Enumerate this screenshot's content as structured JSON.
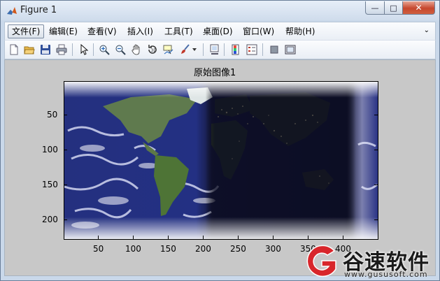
{
  "window": {
    "title": "Figure 1",
    "min_label": "—",
    "max_label": "□",
    "close_label": "✕"
  },
  "menubar": {
    "items": [
      "文件(F)",
      "编辑(E)",
      "查看(V)",
      "插入(I)",
      "工具(T)",
      "桌面(D)",
      "窗口(W)",
      "帮助(H)"
    ],
    "overflow_icon": "chevron-icon"
  },
  "toolbar": {
    "buttons": [
      "new-figure-icon",
      "open-file-icon",
      "save-icon",
      "print-icon",
      "edit-plot-arrow-icon",
      "zoom-in-icon",
      "zoom-out-icon",
      "pan-hand-icon",
      "rotate-3d-icon",
      "data-cursor-icon",
      "brush-icon",
      "dropdown-icon",
      "link-plot-icon",
      "colorbar-icon",
      "legend-icon",
      "hide-plot-tools-icon",
      "show-plot-tools-icon"
    ]
  },
  "plot": {
    "title": "原始图像1",
    "x_ticks": [
      "50",
      "100",
      "150",
      "200",
      "250",
      "300",
      "350",
      "400"
    ],
    "y_ticks": [
      "50",
      "100",
      "150",
      "200"
    ]
  },
  "watermark": {
    "brand": "谷速软件",
    "url": "www.gususoft.com"
  },
  "colors": {
    "accent_close": "#c6472d",
    "figure_bg": "#c8c8c8",
    "ocean": "#24307f",
    "night": "#141633"
  }
}
